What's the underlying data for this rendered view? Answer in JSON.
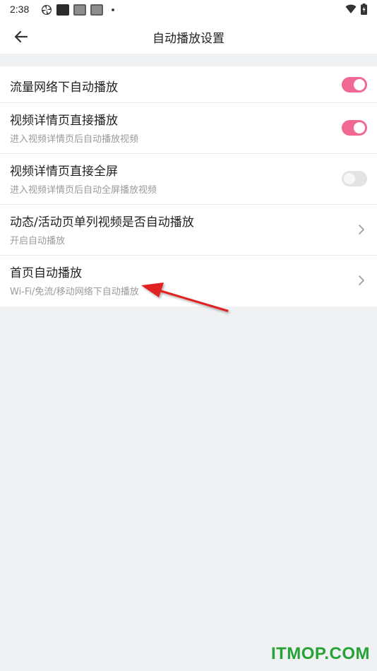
{
  "status_bar": {
    "time": "2:38",
    "icons": [
      "pinwheel-icon",
      "app-icon-dark",
      "app-icon-gray",
      "app-icon-gray-2",
      "dot-icon",
      "wifi-icon",
      "battery-icon"
    ]
  },
  "app_bar": {
    "title": "自动播放设置",
    "back_icon": "arrow-left-icon"
  },
  "settings": [
    {
      "title": "流量网络下自动播放",
      "subtitle": "",
      "control": "toggle",
      "on": true
    },
    {
      "title": "视频详情页直接播放",
      "subtitle": "进入视频详情页后自动播放视频",
      "control": "toggle",
      "on": true
    },
    {
      "title": "视频详情页直接全屏",
      "subtitle": "进入视频详情页后自动全屏播放视频",
      "control": "toggle",
      "on": false
    },
    {
      "title": "动态/活动页单列视频是否自动播放",
      "subtitle": "开启自动播放",
      "control": "chevron"
    },
    {
      "title": "首页自动播放",
      "subtitle": "Wi-Fi/免流/移动网络下自动播放",
      "control": "chevron"
    }
  ],
  "colors": {
    "accent": "#f16992",
    "toggle_off": "#e3e3e3",
    "background": "#f0f1f3",
    "annotation_arrow": "#e02020",
    "watermark": "#26a336"
  },
  "watermark": "ITMOP.COM"
}
